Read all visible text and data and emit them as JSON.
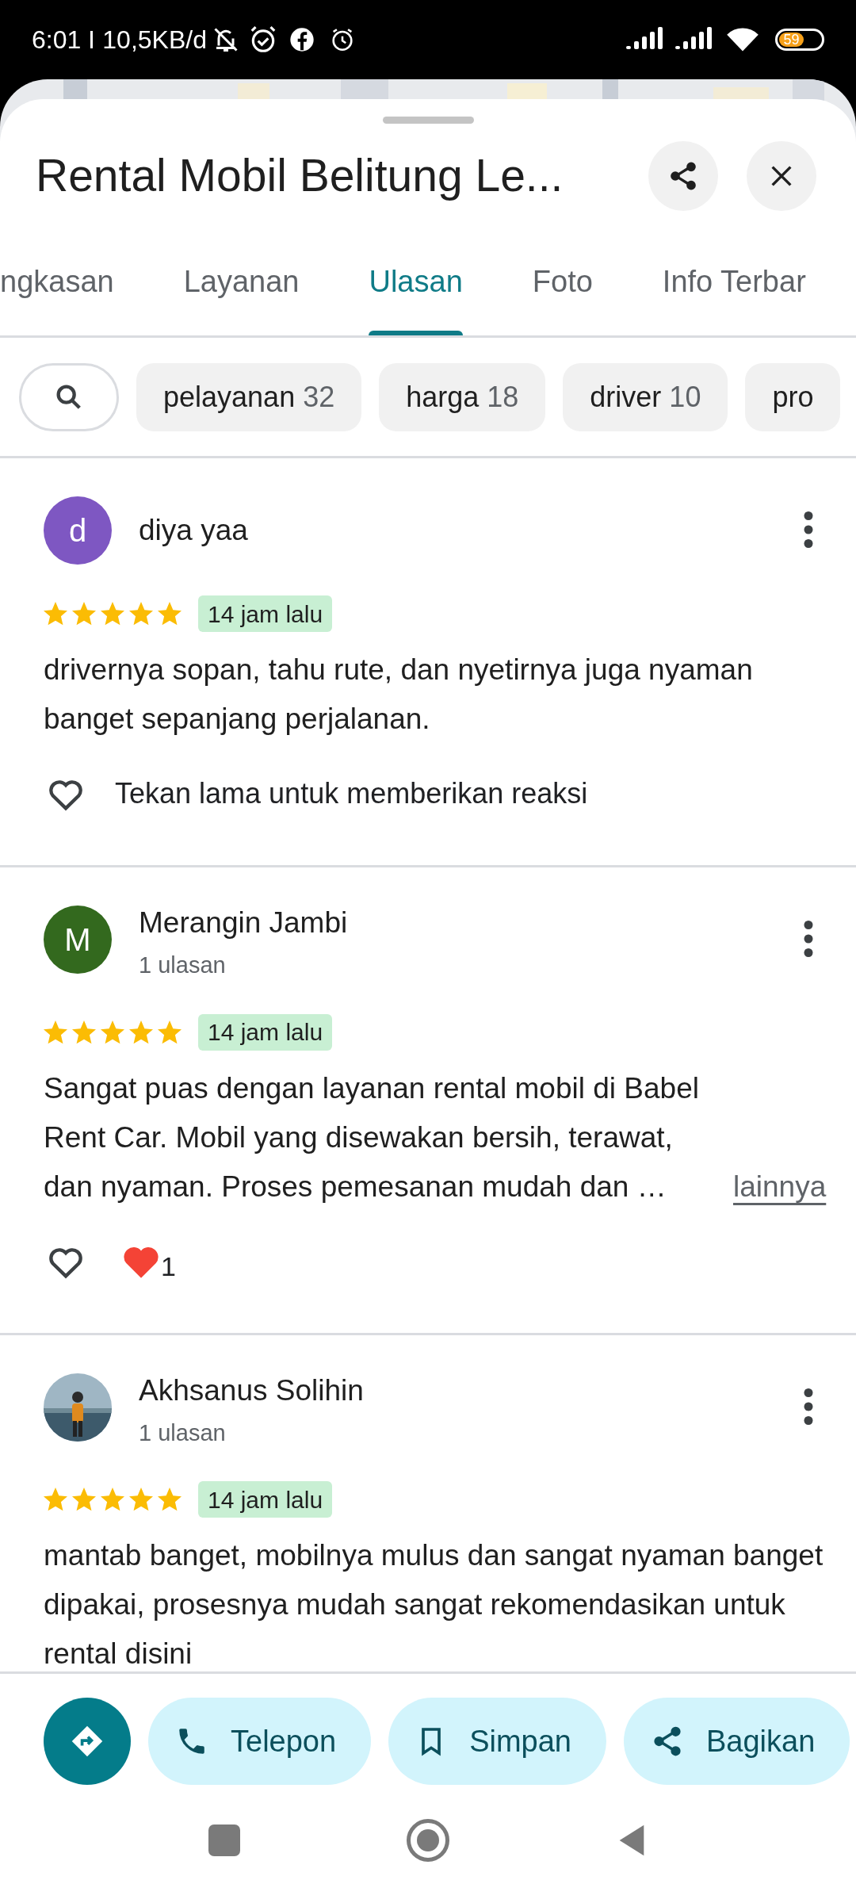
{
  "status_bar": {
    "time": "6:01",
    "speed": "10,5KB/d",
    "battery": "59"
  },
  "header": {
    "title": "Rental Mobil Belitung Le..."
  },
  "tabs": [
    {
      "label": "ngkasan",
      "selected": false
    },
    {
      "label": "Layanan",
      "selected": false
    },
    {
      "label": "Ulasan",
      "selected": true
    },
    {
      "label": "Foto",
      "selected": false
    },
    {
      "label": "Info Terbar",
      "selected": false
    }
  ],
  "filter_chips": [
    {
      "label": "pelayanan",
      "count": "32"
    },
    {
      "label": "harga",
      "count": "18"
    },
    {
      "label": "driver",
      "count": "10"
    },
    {
      "label": "pro"
    }
  ],
  "reviews": [
    {
      "avatar": {
        "kind": "letter",
        "letter": "d",
        "color": "#7e57c2"
      },
      "name": "diya yaa",
      "stars": 5,
      "time": "14 jam lalu",
      "text": "drivernya sopan, tahu rute, dan nyetirnya juga nyaman banget sepanjang perjalanan.",
      "reaction": {
        "kind": "hint",
        "text": "Tekan lama untuk memberikan reaksi"
      }
    },
    {
      "avatar": {
        "kind": "letter",
        "letter": "M",
        "color": "#33691e"
      },
      "name": "Merangin Jambi",
      "subtitle": "1 ulasan",
      "stars": 5,
      "time": "14 jam lalu",
      "text": "Sangat puas dengan layanan rental mobil di Babel Rent Car. Mobil yang disewakan bersih, terawat, dan nyaman. Proses pemesanan mudah dan …",
      "more": "lainnya",
      "reaction": {
        "kind": "count",
        "count": "1"
      }
    },
    {
      "name": "Akhsanus Solihin",
      "subtitle": "1 ulasan",
      "stars": 5,
      "time": "14 jam lalu",
      "text": "mantab banget, mobilnya mulus dan sangat nyaman banget dipakai, prosesnya mudah sangat rekomendasikan untuk rental disini"
    }
  ],
  "actions": [
    "Telepon",
    "Simpan",
    "Bagikan"
  ]
}
